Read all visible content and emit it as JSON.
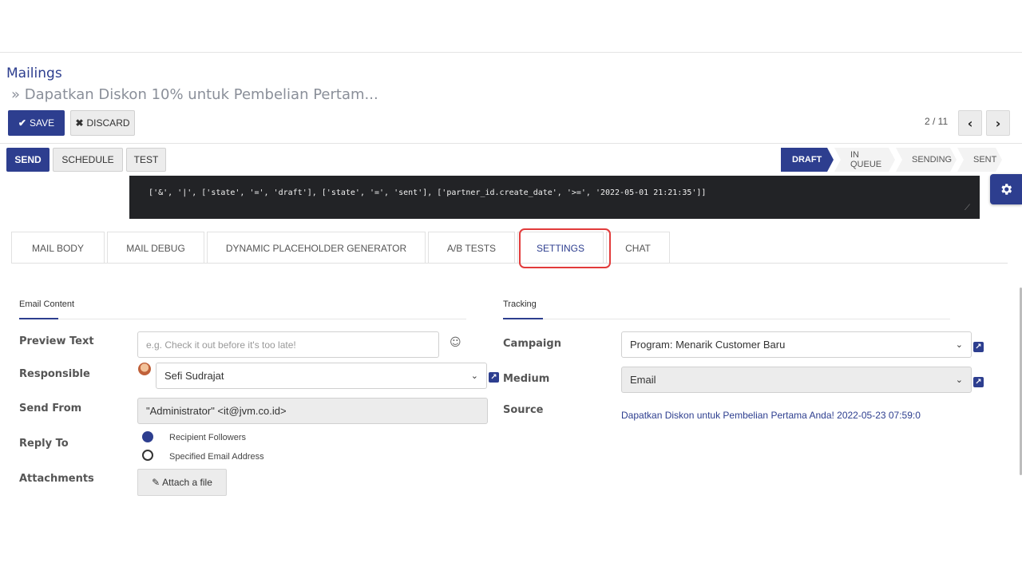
{
  "breadcrumb": {
    "root": "Mailings",
    "record": "» Dapatkan Diskon 10% untuk Pembelian Pertam..."
  },
  "toolbar": {
    "save_label": "SAVE",
    "discard_label": "DISCARD",
    "pager": "2 / 11",
    "prev_icon": "chevron-left-icon",
    "next_icon": "chevron-right-icon"
  },
  "actions": {
    "send_label": "SEND",
    "schedule_label": "SCHEDULE",
    "test_label": "TEST"
  },
  "statusbar": {
    "stages": [
      "DRAFT",
      "IN QUEUE",
      "SENDING",
      "SENT"
    ],
    "active": "DRAFT"
  },
  "domain": "['&', '|', ['state', '=', 'draft'], ['state', '=', 'sent'], ['partner_id.create_date', '>=', '2022-05-01 21:21:35']]",
  "tabs": [
    "MAIL BODY",
    "MAIL DEBUG",
    "DYNAMIC PLACEHOLDER GENERATOR",
    "A/B TESTS",
    "SETTINGS",
    "CHAT"
  ],
  "active_tab": "SETTINGS",
  "email_content": {
    "title": "Email Content",
    "preview_text_label": "Preview Text",
    "preview_text_placeholder": "e.g. Check it out before it's too late!",
    "responsible_label": "Responsible",
    "responsible_value": "Sefi Sudrajat",
    "send_from_label": "Send From",
    "send_from_value": "\"Administrator\" <it@jvm.co.id>",
    "reply_to_label": "Reply To",
    "reply_options": [
      "Recipient Followers",
      "Specified Email Address"
    ],
    "reply_selected": "Recipient Followers",
    "attachments_label": "Attachments",
    "attach_label": "Attach a file"
  },
  "tracking": {
    "title": "Tracking",
    "campaign_label": "Campaign",
    "campaign_value": "Program: Menarik Customer Baru",
    "medium_label": "Medium",
    "medium_value": "Email",
    "source_label": "Source",
    "source_value": "Dapatkan Diskon untuk Pembelian Pertama Anda! 2022-05-23 07:59:0"
  },
  "colors": {
    "primary": "#2d3e8f",
    "highlight": "#e23b3b"
  }
}
